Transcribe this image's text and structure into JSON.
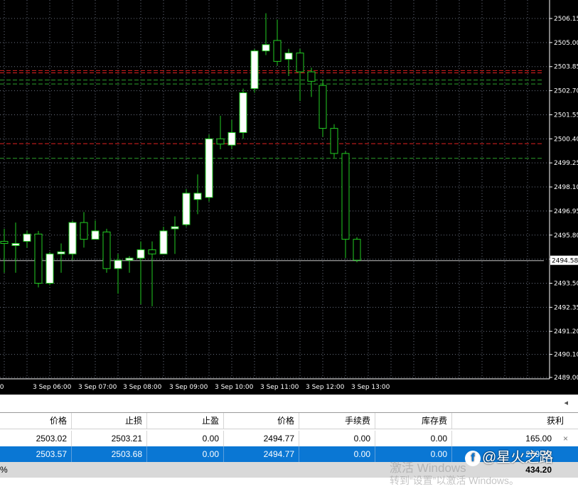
{
  "chart_data": {
    "type": "candlestick",
    "ylim": [
      2489.0,
      2507.0
    ],
    "y_ticks": [
      "2506.15",
      "2505.00",
      "2503.85",
      "2502.70",
      "2501.55",
      "2500.40",
      "2499.25",
      "2498.10",
      "2496.95",
      "2495.80",
      "2494.65",
      "2493.50",
      "2492.35",
      "2491.20",
      "2490.10",
      "2489.00"
    ],
    "x_ticks": [
      "00",
      "3 Sep 06:00",
      "3 Sep 07:00",
      "3 Sep 08:00",
      "3 Sep 09:00",
      "3 Sep 10:00",
      "3 Sep 11:00",
      "3 Sep 12:00",
      "3 Sep 13:00"
    ],
    "current_price_label": "2494.58",
    "current_price": 2494.58,
    "hlines": [
      {
        "price": 2503.66,
        "color": "#e02020",
        "style": "dash"
      },
      {
        "price": 2503.55,
        "color": "#e02020",
        "style": "dash"
      },
      {
        "price": 2503.21,
        "color": "#2ca02c",
        "style": "dash"
      },
      {
        "price": 2503.02,
        "color": "#2ca02c",
        "style": "dash"
      },
      {
        "price": 2500.17,
        "color": "#e02020",
        "style": "dash"
      },
      {
        "price": 2499.47,
        "color": "#2ca02c",
        "style": "dash"
      },
      {
        "price": 2494.58,
        "color": "#c0c0c0",
        "style": "solid"
      }
    ],
    "candles": [
      {
        "t": 0,
        "o": 2495.5,
        "h": 2496.1,
        "l": 2494.0,
        "c": 2495.4
      },
      {
        "t": 1,
        "o": 2495.3,
        "h": 2496.4,
        "l": 2494.0,
        "c": 2495.4
      },
      {
        "t": 2,
        "o": 2495.5,
        "h": 2496.0,
        "l": 2495.2,
        "c": 2495.85
      },
      {
        "t": 3,
        "o": 2495.85,
        "h": 2496.0,
        "l": 2493.3,
        "c": 2493.5
      },
      {
        "t": 4,
        "o": 2493.5,
        "h": 2495.0,
        "l": 2493.4,
        "c": 2494.9
      },
      {
        "t": 5,
        "o": 2494.9,
        "h": 2495.4,
        "l": 2494.0,
        "c": 2495.0
      },
      {
        "t": 6,
        "o": 2494.9,
        "h": 2496.5,
        "l": 2494.6,
        "c": 2496.4
      },
      {
        "t": 7,
        "o": 2496.4,
        "h": 2496.9,
        "l": 2495.2,
        "c": 2495.6
      },
      {
        "t": 8,
        "o": 2495.6,
        "h": 2496.5,
        "l": 2495.6,
        "c": 2496.0
      },
      {
        "t": 9,
        "o": 2495.95,
        "h": 2496.1,
        "l": 2494.0,
        "c": 2494.2
      },
      {
        "t": 10,
        "o": 2494.2,
        "h": 2494.9,
        "l": 2493.0,
        "c": 2494.6
      },
      {
        "t": 11,
        "o": 2494.6,
        "h": 2494.8,
        "l": 2494.0,
        "c": 2494.7
      },
      {
        "t": 12,
        "o": 2494.7,
        "h": 2495.5,
        "l": 2492.5,
        "c": 2495.1
      },
      {
        "t": 13,
        "o": 2495.1,
        "h": 2495.5,
        "l": 2492.4,
        "c": 2494.9
      },
      {
        "t": 14,
        "o": 2494.9,
        "h": 2496.2,
        "l": 2494.9,
        "c": 2496.0
      },
      {
        "t": 15,
        "o": 2496.1,
        "h": 2496.7,
        "l": 2494.9,
        "c": 2496.2
      },
      {
        "t": 16,
        "o": 2496.3,
        "h": 2498.0,
        "l": 2496.2,
        "c": 2497.8
      },
      {
        "t": 17,
        "o": 2497.5,
        "h": 2498.7,
        "l": 2496.8,
        "c": 2497.8
      },
      {
        "t": 18,
        "o": 2497.6,
        "h": 2500.6,
        "l": 2497.4,
        "c": 2500.4
      },
      {
        "t": 19,
        "o": 2500.4,
        "h": 2501.5,
        "l": 2499.9,
        "c": 2500.15
      },
      {
        "t": 20,
        "o": 2500.1,
        "h": 2501.3,
        "l": 2499.9,
        "c": 2500.7
      },
      {
        "t": 21,
        "o": 2500.7,
        "h": 2502.8,
        "l": 2500.4,
        "c": 2502.6
      },
      {
        "t": 22,
        "o": 2502.8,
        "h": 2504.7,
        "l": 2502.6,
        "c": 2504.6
      },
      {
        "t": 23,
        "o": 2504.6,
        "h": 2506.4,
        "l": 2504.4,
        "c": 2504.9
      },
      {
        "t": 24,
        "o": 2505.1,
        "h": 2506.1,
        "l": 2503.9,
        "c": 2504.1
      },
      {
        "t": 25,
        "o": 2504.2,
        "h": 2504.7,
        "l": 2503.4,
        "c": 2504.5
      },
      {
        "t": 26,
        "o": 2504.5,
        "h": 2504.7,
        "l": 2502.2,
        "c": 2503.6
      },
      {
        "t": 27,
        "o": 2503.6,
        "h": 2503.8,
        "l": 2502.4,
        "c": 2503.15
      },
      {
        "t": 28,
        "o": 2502.95,
        "h": 2503.2,
        "l": 2500.5,
        "c": 2500.9
      },
      {
        "t": 29,
        "o": 2500.9,
        "h": 2501.1,
        "l": 2499.5,
        "c": 2499.7
      },
      {
        "t": 30,
        "o": 2499.7,
        "h": 2499.8,
        "l": 2494.7,
        "c": 2495.6
      },
      {
        "t": 31,
        "o": 2495.6,
        "h": 2495.7,
        "l": 2494.5,
        "c": 2494.6
      }
    ]
  },
  "scroll": {
    "right_arrow": "◂"
  },
  "table": {
    "headers": [
      "价格",
      "止损",
      "止盈",
      "价格",
      "手续费",
      "库存费",
      "获利"
    ],
    "rows": [
      {
        "price_open": "2503.02",
        "sl": "2503.21",
        "tp": "0.00",
        "price_cur": "2494.77",
        "commission": "0.00",
        "swap": "0.00",
        "profit": "165.00"
      },
      {
        "price_open": "2503.57",
        "sl": "2503.68",
        "tp": "0.00",
        "price_cur": "2494.77",
        "commission": "0.00",
        "swap": "0.00",
        "profit": "269.20"
      }
    ],
    "total_prefix": "%",
    "total": "434.20",
    "close_glyph": "×"
  },
  "overlay": {
    "watermark_line1": "激活 Windows",
    "watermark_line2": "转到“设置”以激活 Windows。",
    "brand_icon": "f",
    "brand_text": "@星火之路"
  }
}
